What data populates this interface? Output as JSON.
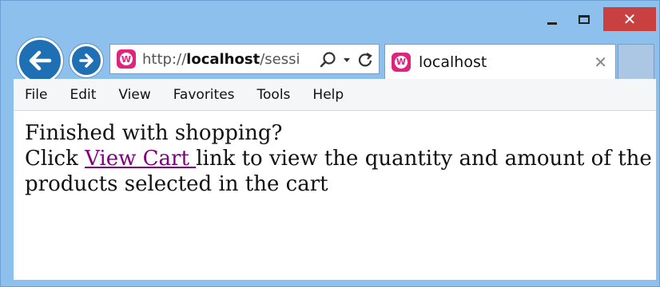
{
  "window": {
    "caption": {
      "minimize_icon": "minimize-icon",
      "maximize_icon": "maximize-icon",
      "close_glyph": "✕"
    }
  },
  "nav": {
    "back_icon": "back-arrow-icon",
    "forward_icon": "forward-arrow-icon"
  },
  "address_bar": {
    "url_prefix": "http://",
    "url_host": "localhost",
    "url_rest": "/sessic",
    "site_icon": "webmatrix-icon"
  },
  "tab": {
    "title": "localhost",
    "close_glyph": "✕"
  },
  "menu": [
    "File",
    "Edit",
    "View",
    "Favorites",
    "Tools",
    "Help"
  ],
  "page": {
    "line1": "Finished with shopping?",
    "line2_before": "Click ",
    "link_text": "View Cart ",
    "line2_after": "link to view the quantity and amount of the products selected in the cart"
  },
  "colors": {
    "link": "#800080",
    "close_button": "#c84040",
    "nav_button": "#1f6fb4",
    "site_icon": "#e0237e"
  }
}
